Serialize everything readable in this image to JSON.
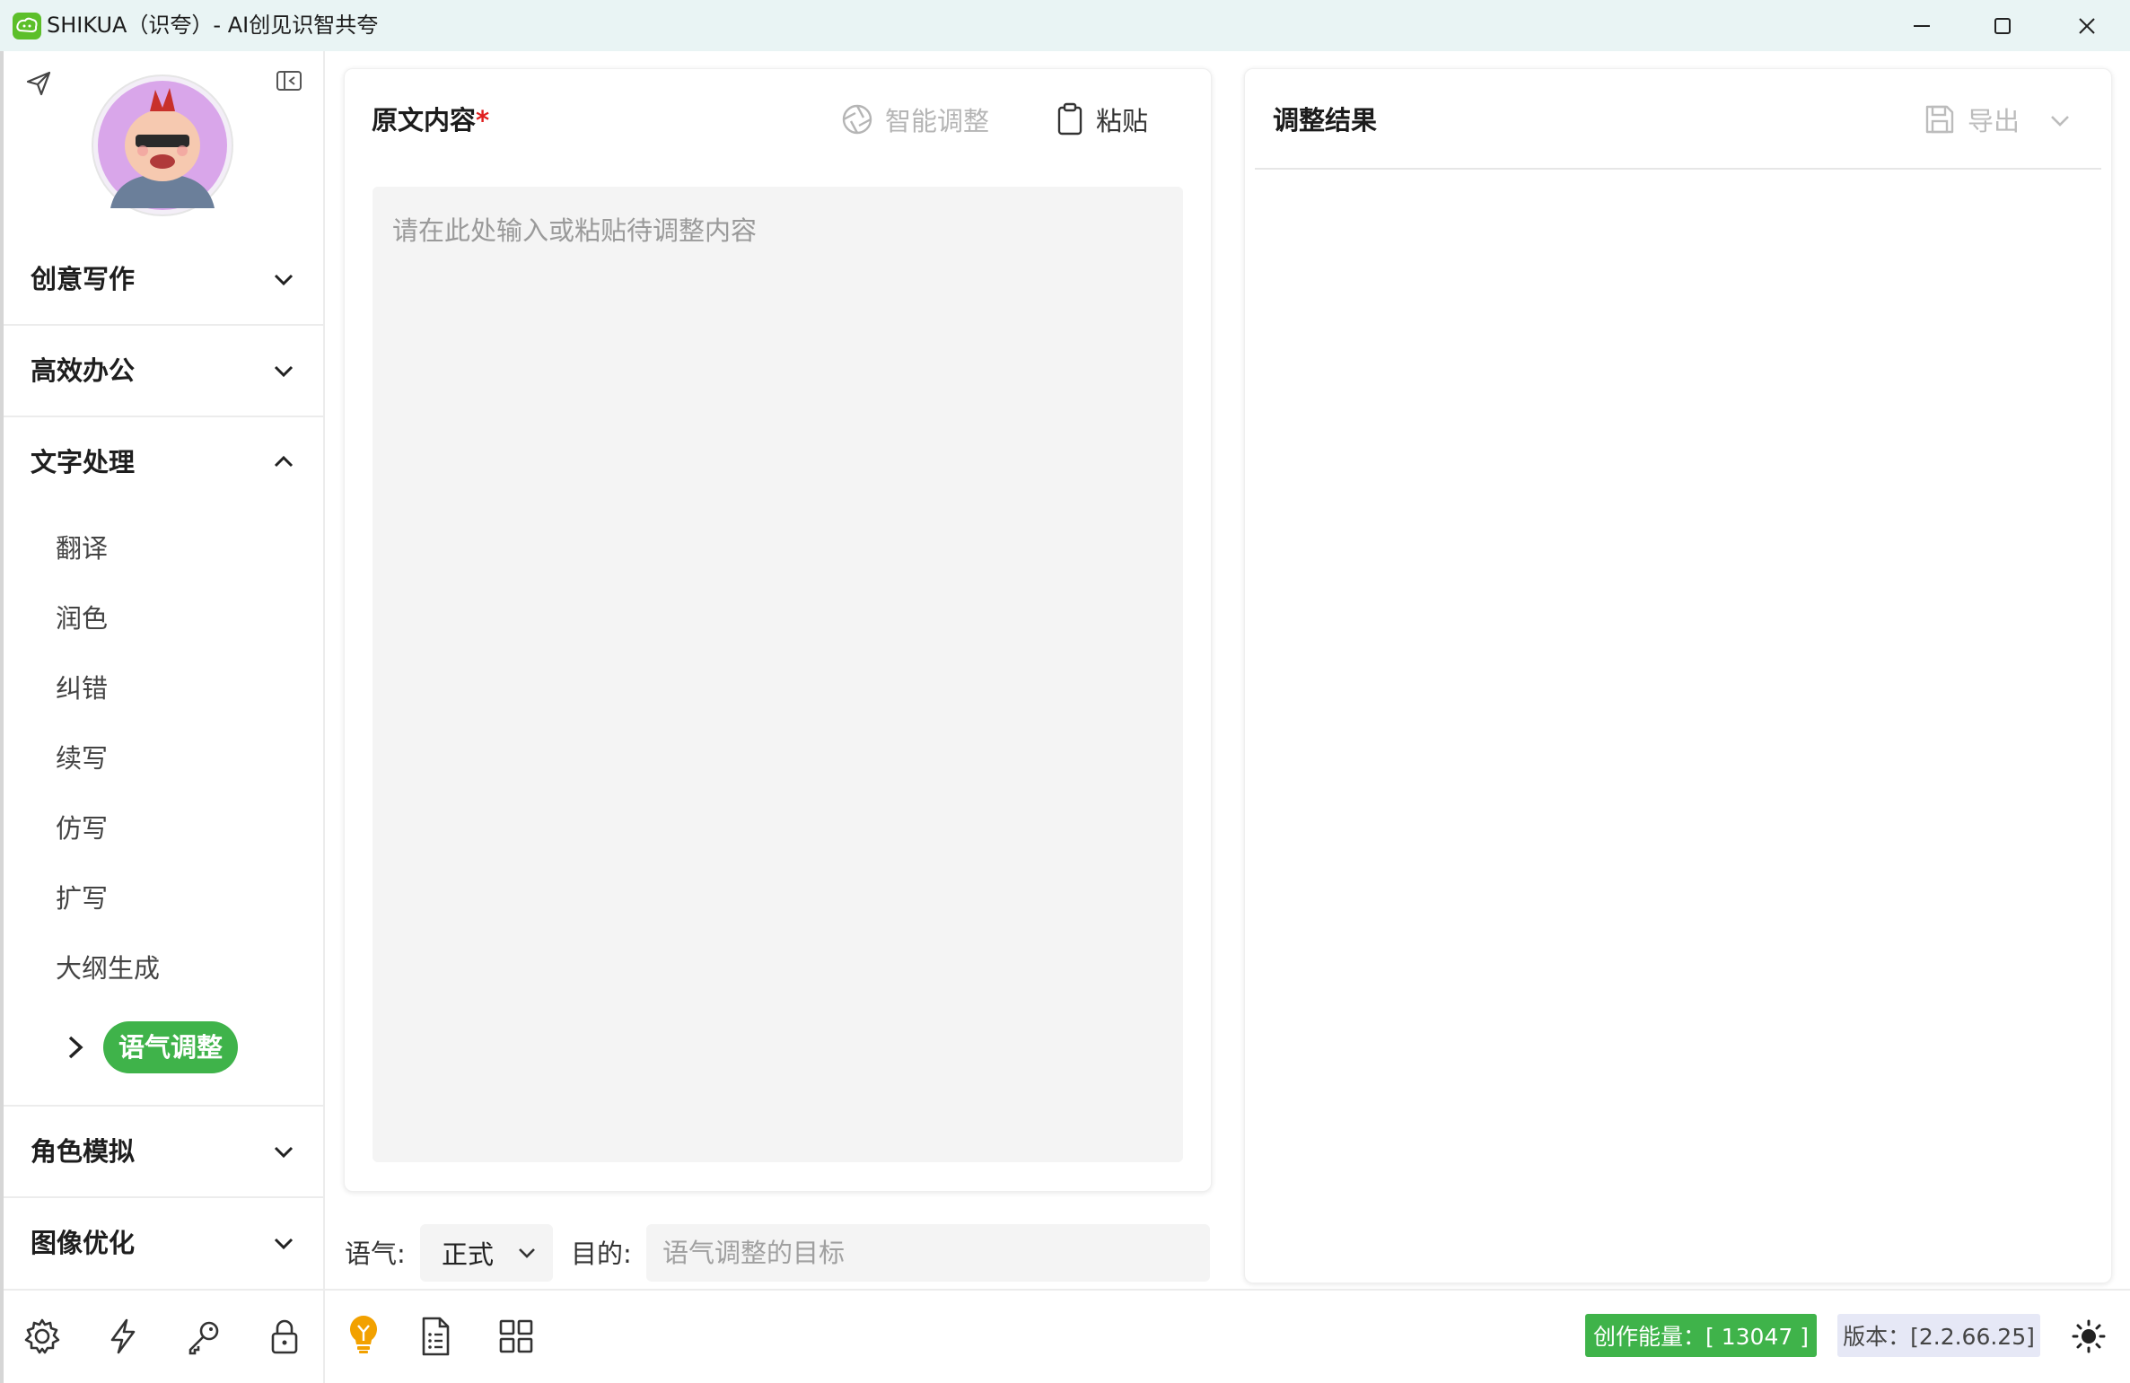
{
  "window": {
    "title": "SHIKUA（识夸）- AI创见识智共夸",
    "controls": [
      "minimize-icon",
      "maximize-icon",
      "close-icon"
    ]
  },
  "sidebar": {
    "categories": [
      {
        "label": "创意写作",
        "expanded": false
      },
      {
        "label": "高效办公",
        "expanded": false
      },
      {
        "label": "文字处理",
        "expanded": true
      },
      {
        "label": "角色模拟",
        "expanded": false
      },
      {
        "label": "图像优化",
        "expanded": false
      }
    ],
    "text_items": [
      "翻译",
      "润色",
      "纠错",
      "续写",
      "仿写",
      "扩写",
      "大纲生成",
      "语气调整"
    ],
    "active_item": "语气调整",
    "accent_color": "#3fb34a"
  },
  "left_panel": {
    "title": "原文内容",
    "required_mark": "*",
    "smart_button": "智能调整",
    "paste_button": "粘贴",
    "placeholder": "请在此处输入或粘贴待调整内容"
  },
  "right_panel": {
    "title": "调整结果",
    "export_button": "导出"
  },
  "controls": {
    "tone_label": "语气:",
    "tone_value": "正式",
    "goal_label": "目的:",
    "goal_placeholder": "语气调整的目标"
  },
  "status": {
    "energy": "创作能量：[ 13047 ]",
    "version": "版本：[2.2.66.25]"
  },
  "bottom_icons": [
    "settings-icon",
    "lightning-icon",
    "key-icon",
    "lock-icon",
    "bulb-icon",
    "document-list-icon",
    "grid-icon",
    "theme-sun-icon"
  ]
}
